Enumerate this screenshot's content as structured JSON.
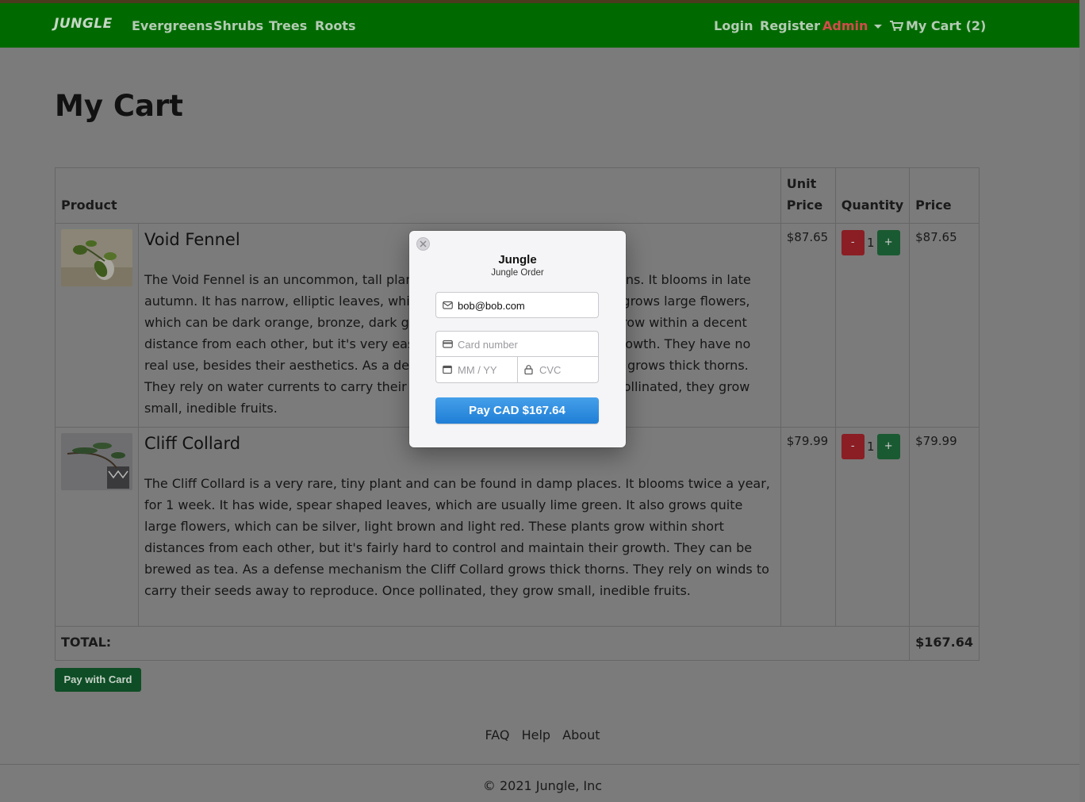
{
  "nav": {
    "brand": "JUNGLE",
    "left_links": [
      "Evergreens",
      "Shrubs",
      "Trees",
      "Roots"
    ],
    "login": "Login",
    "register": "Register",
    "admin": "Admin",
    "cart": "My Cart (2)"
  },
  "page": {
    "title": "My Cart"
  },
  "table": {
    "headers": {
      "product": "Product",
      "unit_price": "Unit Price",
      "quantity": "Quantity",
      "price": "Price"
    },
    "rows": [
      {
        "name": "Void Fennel",
        "description": "The Void Fennel is an uncommon, tall plant and can be found in damp regions. It blooms in late autumn. It has narrow, elliptic leaves, which are usually dark green. It also grows large flowers, which can be dark orange, bronze, dark grey and dark pink. These plants grow within a decent distance from each other, but it's very easy to control and maintain their growth. They have no real use, besides their aesthetics. As a defense mechanism the Void Fennel grows thick thorns. They rely on water currents to carry their seeds away to reproduce. Once pollinated, they grow small, inedible fruits.",
        "unit_price": "$87.65",
        "minus": "-",
        "qty": "1",
        "plus": "+",
        "price": "$87.65"
      },
      {
        "name": "Cliff Collard",
        "description": "The Cliff Collard is a very rare, tiny plant and can be found in damp places. It blooms twice a year, for 1 week. It has wide, spear shaped leaves, which are usually lime green. It also grows quite large flowers, which can be silver, light brown and light red. These plants grow within short distances from each other, but it's fairly hard to control and maintain their growth. They can be brewed as tea. As a defense mechanism the Cliff Collard grows thick thorns. They rely on winds to carry their seeds away to reproduce. Once pollinated, they grow small, inedible fruits.",
        "unit_price": "$79.99",
        "minus": "-",
        "qty": "1",
        "plus": "+",
        "price": "$79.99"
      }
    ],
    "total_label": "TOTAL:",
    "total_value": "$167.64"
  },
  "pay_button": "Pay with Card",
  "footer": {
    "links": [
      "FAQ",
      "Help",
      "About"
    ],
    "copyright": "© 2021 Jungle, Inc"
  },
  "checkout": {
    "title": "Jungle",
    "subtitle": "Jungle Order",
    "email_value": "bob@bob.com",
    "card_placeholder": "Card number",
    "exp_placeholder": "MM / YY",
    "cvc_placeholder": "CVC",
    "pay_label": "Pay CAD $167.64",
    "close_icon": "close-icon"
  },
  "colors": {
    "navbar": "#006a00",
    "admin": "#d44b4b",
    "pay_button": "#0e4d26",
    "stripe_pay": "#2f8ee0"
  }
}
